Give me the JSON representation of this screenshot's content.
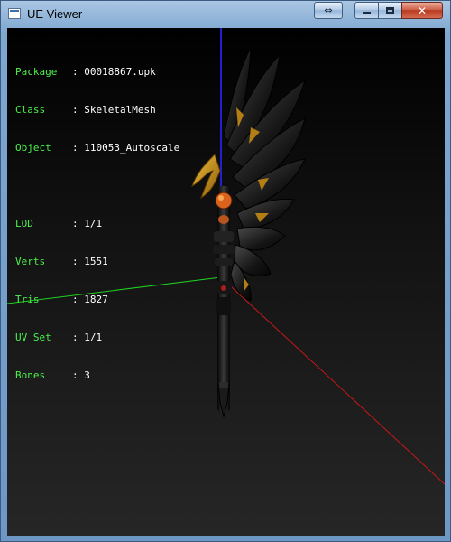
{
  "window": {
    "title": "UE Viewer",
    "buttons": {
      "resize_icon": "resize-arrows-icon",
      "minimize_icon": "minimize-icon",
      "maximize_icon": "maximize-icon",
      "close_glyph": "✕"
    }
  },
  "info": {
    "object": [
      {
        "key": "Package",
        "value": ": 00018867.upk"
      },
      {
        "key": "Class",
        "value": ": SkeletalMesh"
      },
      {
        "key": "Object",
        "value": ": 110053_Autoscale"
      }
    ],
    "mesh": [
      {
        "key": "LOD",
        "value": ": 1/1"
      },
      {
        "key": "Verts",
        "value": ": 1551"
      },
      {
        "key": "Tris",
        "value": ": 1827"
      },
      {
        "key": "UV Set",
        "value": ": 1/1"
      },
      {
        "key": "Bones",
        "value": ": 3"
      }
    ]
  },
  "colors": {
    "label_green": "#4cf04c",
    "axis_x": "#c81818",
    "axis_y": "#20d020",
    "axis_z": "#2020d0"
  }
}
